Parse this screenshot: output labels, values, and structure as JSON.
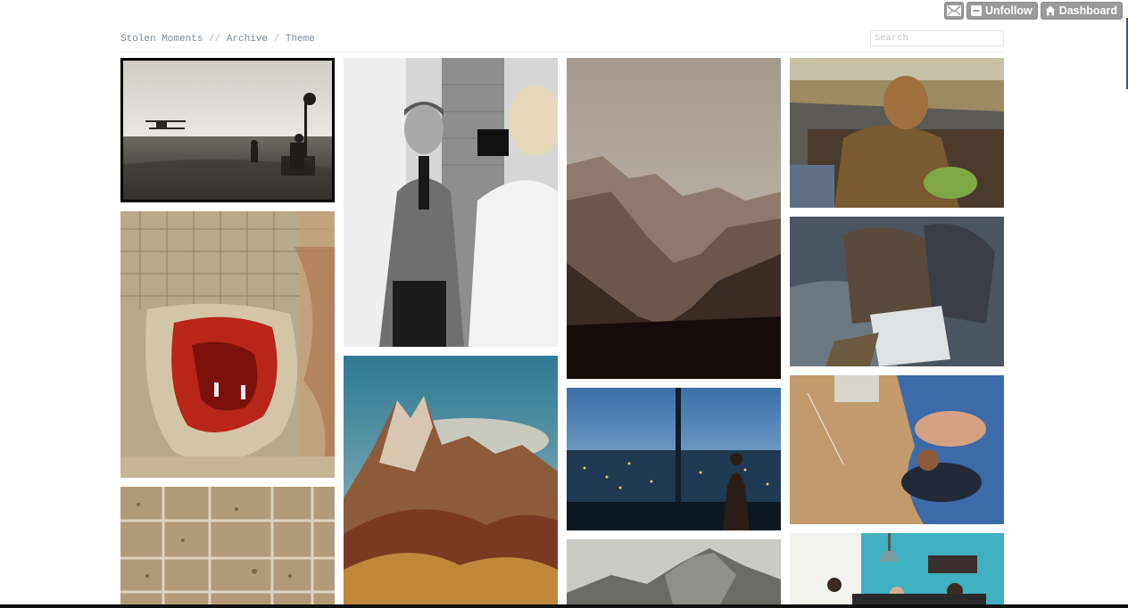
{
  "controls": {
    "unfollow_label": "Unfollow",
    "dashboard_label": "Dashboard"
  },
  "nav": {
    "title": "Stolen Moments",
    "sep1": " // ",
    "archive": "Archive",
    "sep2": " / ",
    "theme": "Theme"
  },
  "search": {
    "placeholder": "Search"
  },
  "colors": {
    "button_gray": "#9a9a9a",
    "nav_text": "#7c8a96"
  }
}
